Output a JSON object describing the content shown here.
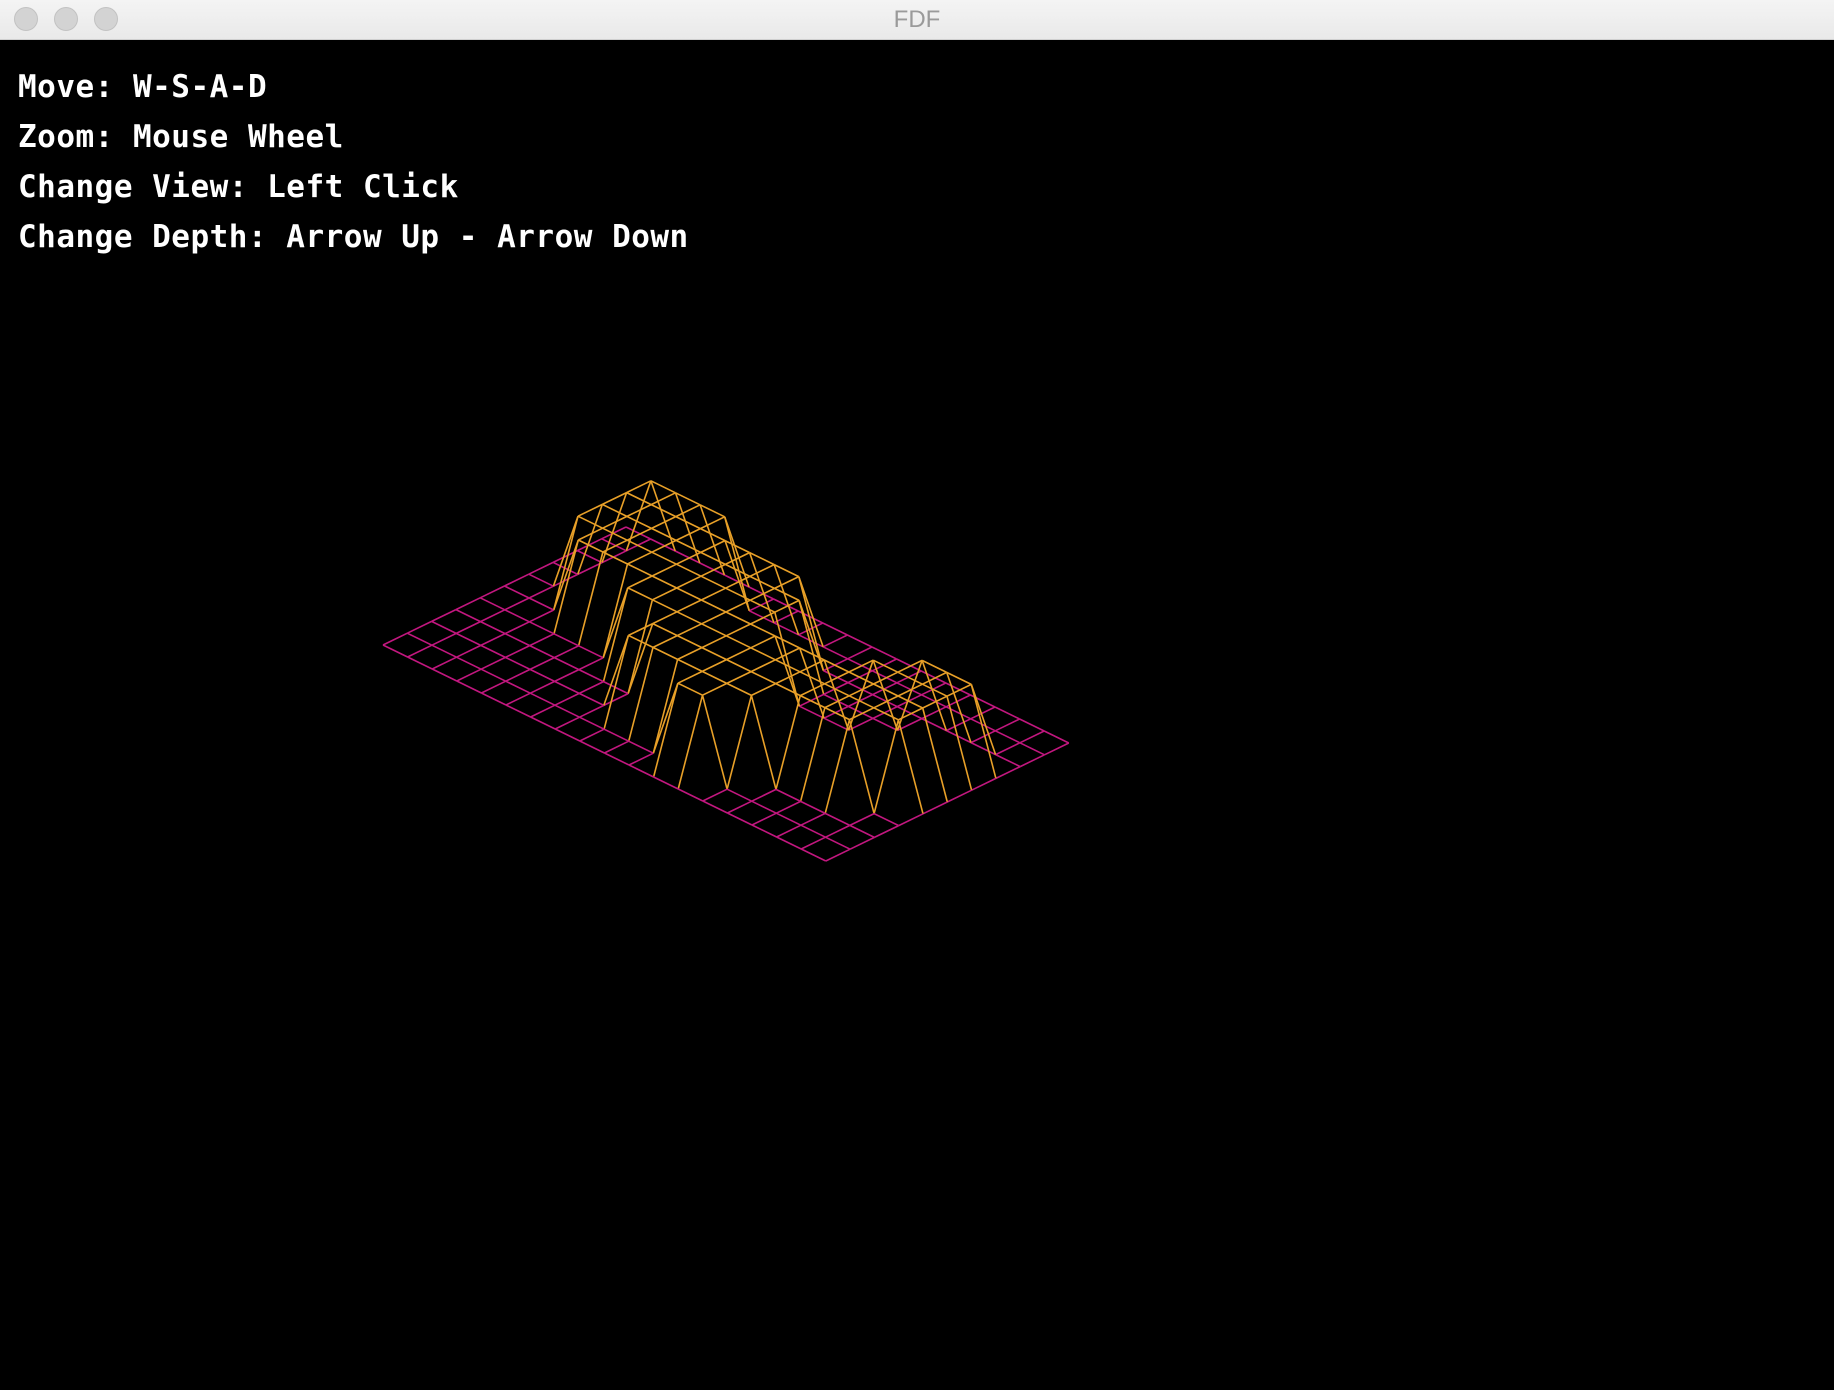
{
  "window": {
    "title": "FDF"
  },
  "help": [
    "Move: W-S-A-D",
    "Zoom: Mouse Wheel",
    "Change View: Left Click",
    "Change Depth: Arrow Up - Arrow Down"
  ],
  "colors": {
    "background": "#000000",
    "base_line": "#c2177f",
    "raised_line": "#e8a028",
    "text": "#ffffff"
  },
  "wireframe": {
    "projection": "isometric",
    "rows": 11,
    "cols": 19,
    "heights": [
      [
        0,
        0,
        0,
        0,
        0,
        0,
        0,
        0,
        0,
        0,
        0,
        0,
        0,
        0,
        0,
        0,
        0,
        0,
        0
      ],
      [
        0,
        0,
        10,
        10,
        10,
        10,
        0,
        0,
        0,
        0,
        0,
        0,
        0,
        0,
        0,
        0,
        0,
        0,
        0
      ],
      [
        0,
        0,
        10,
        10,
        10,
        10,
        10,
        10,
        10,
        10,
        0,
        0,
        0,
        0,
        0,
        0,
        0,
        0,
        0
      ],
      [
        0,
        0,
        10,
        10,
        10,
        10,
        10,
        10,
        10,
        10,
        10,
        0,
        0,
        0,
        0,
        10,
        10,
        10,
        0
      ],
      [
        0,
        0,
        10,
        10,
        10,
        10,
        10,
        10,
        10,
        10,
        10,
        0,
        0,
        0,
        10,
        10,
        10,
        10,
        0
      ],
      [
        0,
        0,
        0,
        10,
        10,
        10,
        10,
        10,
        10,
        10,
        10,
        10,
        10,
        10,
        10,
        10,
        10,
        10,
        0
      ],
      [
        0,
        0,
        0,
        0,
        0,
        0,
        10,
        10,
        10,
        10,
        10,
        10,
        10,
        10,
        10,
        10,
        10,
        10,
        0
      ],
      [
        0,
        0,
        0,
        0,
        0,
        0,
        0,
        0,
        10,
        10,
        10,
        10,
        10,
        10,
        10,
        10,
        10,
        0,
        0
      ],
      [
        0,
        0,
        0,
        0,
        0,
        0,
        0,
        0,
        10,
        10,
        10,
        10,
        10,
        10,
        0,
        0,
        0,
        0,
        0
      ],
      [
        0,
        0,
        0,
        0,
        0,
        0,
        0,
        0,
        0,
        0,
        0,
        10,
        10,
        0,
        0,
        0,
        0,
        0,
        0
      ],
      [
        0,
        0,
        0,
        0,
        0,
        0,
        0,
        0,
        0,
        0,
        0,
        0,
        0,
        0,
        0,
        0,
        0,
        0,
        0
      ]
    ]
  }
}
